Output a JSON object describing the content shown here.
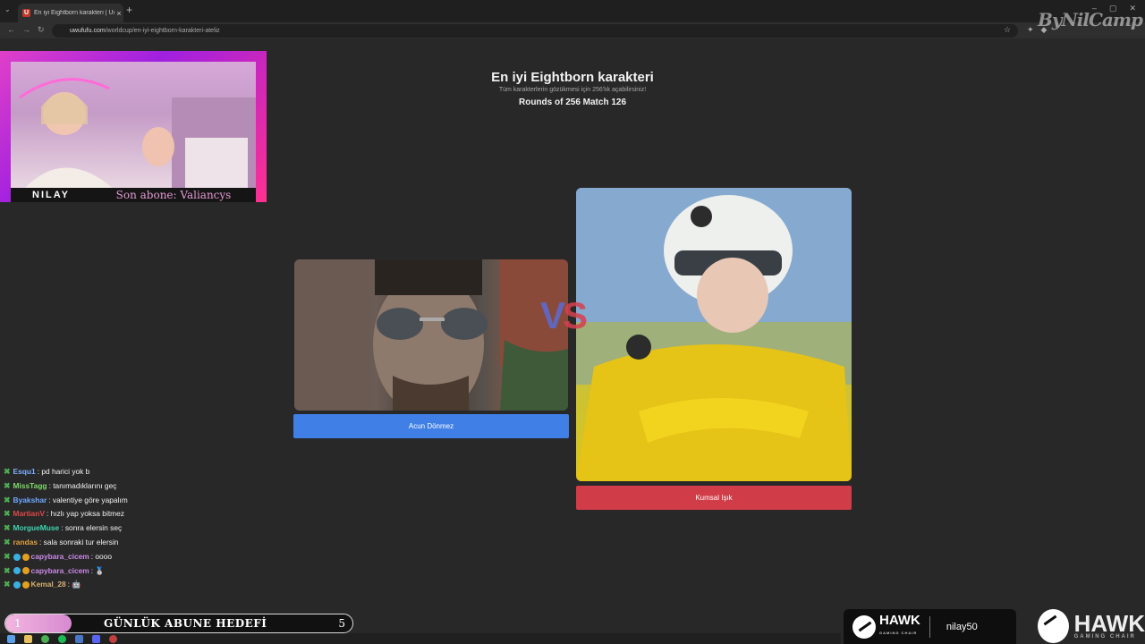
{
  "browser": {
    "tab_title": "En iyi Eightborn karakteri | Uwu",
    "tab_favicon": "U",
    "url_host": "uwufufu.com",
    "url_path": "/worldcup/en-iyi-eightborn-karakteri-ateliz"
  },
  "watermark": "ByNilCamp",
  "page": {
    "title": "En iyi Eightborn karakteri",
    "subtitle": "Tüm karakterlerin gözükmesi için 256'lık açabilirsiniz!",
    "round": "Rounds of 256 Match 126",
    "vs_v": "V",
    "vs_s": "S",
    "left_choice": "Acun Dönmez",
    "right_choice": "Kumsal Işık"
  },
  "webcam": {
    "name": "NILAY",
    "last_sub": "Son abone: Valiancys"
  },
  "chat": [
    {
      "user": "Esqu1",
      "color": "#7fb0ff",
      "text": ": pd harici yok b"
    },
    {
      "user": "MissTagg",
      "color": "#7ddb6a",
      "text": ": tanımadıklarını geç"
    },
    {
      "user": "Byakshar",
      "color": "#6fa8ff",
      "text": ": valentiye göre yapalım"
    },
    {
      "user": "MartianV",
      "color": "#e04848",
      "text": ": hızlı yap yoksa bitmez"
    },
    {
      "user": "MorgueMuse",
      "color": "#3dd6b0",
      "text": ": sonra elersin seç"
    },
    {
      "user": "randas",
      "color": "#e0a040",
      "text": ": sala sonraki tur elersin"
    },
    {
      "user": "capybara_cicem",
      "color": "#c98ae8",
      "text": ": oooo"
    },
    {
      "user": "capybara_cicem",
      "color": "#c98ae8",
      "text": ": 🥈"
    },
    {
      "user": "Kemal_28",
      "color": "#d8b070",
      "text": ": 🤖"
    }
  ],
  "goal": {
    "start": "1",
    "label": "GÜNLÜK ABUNE HEDEFİ",
    "end": "5",
    "progress": 0.19
  },
  "sponsor": {
    "brand": "HAWK",
    "brand_sub": "GAMING CHAIR",
    "code": "nilay50"
  }
}
